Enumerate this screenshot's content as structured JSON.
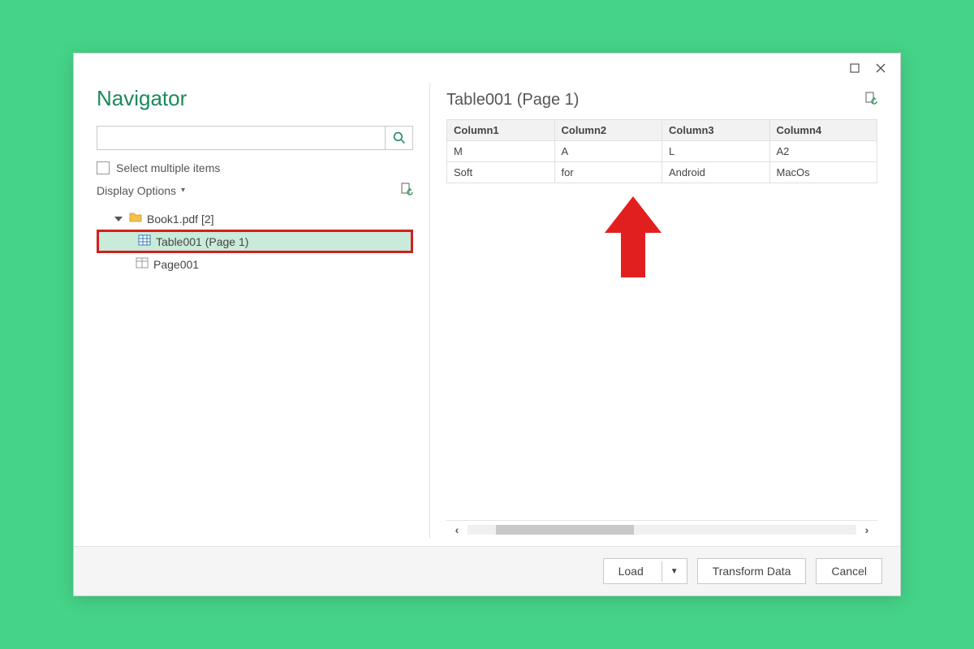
{
  "dialog": {
    "title": "Navigator"
  },
  "search": {
    "placeholder": ""
  },
  "options": {
    "select_multiple_label": "Select multiple items",
    "display_options_label": "Display Options"
  },
  "tree": {
    "root_label": "Book1.pdf [2]",
    "items": [
      {
        "label": "Table001 (Page 1)",
        "selected": true
      },
      {
        "label": "Page001",
        "selected": false
      }
    ]
  },
  "preview": {
    "title": "Table001 (Page 1)",
    "columns": [
      "Column1",
      "Column2",
      "Column3",
      "Column4"
    ],
    "rows": [
      [
        "M",
        "A",
        "L",
        "A2"
      ],
      [
        "Soft",
        "for",
        "Android",
        "MacOs"
      ]
    ]
  },
  "footer": {
    "load_label": "Load",
    "transform_label": "Transform Data",
    "cancel_label": "Cancel"
  },
  "chart_data": {
    "type": "table",
    "title": "Table001 (Page 1)",
    "columns": [
      "Column1",
      "Column2",
      "Column3",
      "Column4"
    ],
    "rows": [
      [
        "M",
        "A",
        "L",
        "A2"
      ],
      [
        "Soft",
        "for",
        "Android",
        "MacOs"
      ]
    ]
  }
}
